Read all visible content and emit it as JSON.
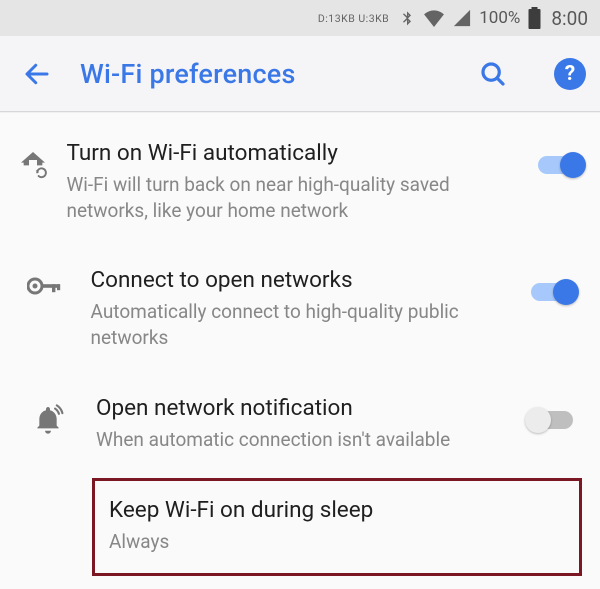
{
  "status": {
    "net_text": "D:13KB  U:3KB",
    "battery_pct": "100%",
    "time": "8:00"
  },
  "appbar": {
    "title": "Wi-Fi preferences",
    "help_glyph": "?"
  },
  "rows": {
    "auto_on": {
      "title": "Turn on Wi-Fi automatically",
      "sub": "Wi-Fi will turn back on near high-quality saved networks, like your home network",
      "enabled": true
    },
    "open_connect": {
      "title": "Connect to open networks",
      "sub": "Automatically connect to high-quality public networks",
      "enabled": true
    },
    "open_notif": {
      "title": "Open network notification",
      "sub": "When automatic connection isn't available",
      "enabled": false
    },
    "sleep": {
      "title": "Keep Wi-Fi on during sleep",
      "value": "Always"
    }
  }
}
